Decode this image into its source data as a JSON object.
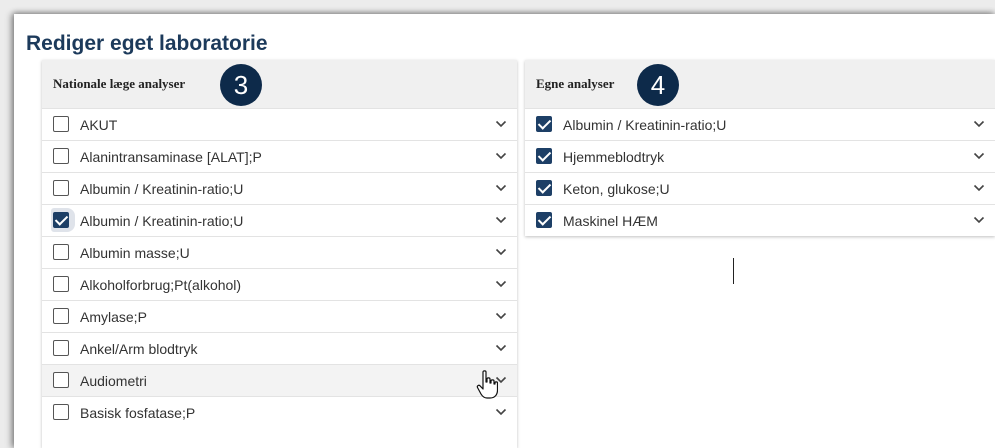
{
  "title": "Rediger eget laboratorie",
  "left": {
    "header": "Nationale læge analyser",
    "badge": "3",
    "items": [
      {
        "label": "AKUT",
        "checked": false
      },
      {
        "label": "Alanintransaminase [ALAT];P",
        "checked": false
      },
      {
        "label": "Albumin / Kreatinin-ratio;U",
        "checked": false
      },
      {
        "label": "Albumin / Kreatinin-ratio;U",
        "checked": true
      },
      {
        "label": "Albumin masse;U",
        "checked": false
      },
      {
        "label": "Alkoholforbrug;Pt(alkohol)",
        "checked": false
      },
      {
        "label": "Amylase;P",
        "checked": false
      },
      {
        "label": "Ankel/Arm blodtryk",
        "checked": false
      },
      {
        "label": "Audiometri",
        "checked": false
      },
      {
        "label": "Basisk fosfatase;P",
        "checked": false
      }
    ]
  },
  "right": {
    "header": "Egne analyser",
    "badge": "4",
    "items": [
      {
        "label": "Albumin / Kreatinin-ratio;U",
        "checked": true
      },
      {
        "label": "Hjemmeblodtryk",
        "checked": true
      },
      {
        "label": "Keton, glukose;U",
        "checked": true
      },
      {
        "label": "Maskinel HÆM",
        "checked": true
      }
    ]
  },
  "colors": {
    "title": "#1c3a5b",
    "badge": "#0d2a4a",
    "checkbox_checked": "#1d3f66"
  },
  "icons": {
    "expand": "chevron-down-icon",
    "cursor": "hand-pointer-icon"
  }
}
